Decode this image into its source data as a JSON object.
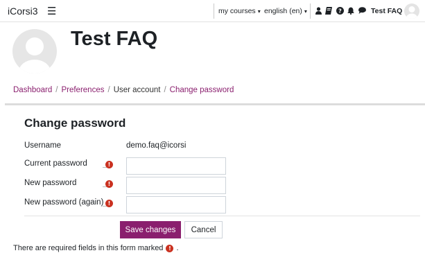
{
  "navbar": {
    "brand": "iCorsi3",
    "my_courses": "my courses",
    "language": "english (en)",
    "caret": "▾",
    "user_name": "Test FAQ",
    "icons": [
      "user-icon",
      "book-icon",
      "help-icon",
      "bell-icon",
      "chat-icon"
    ]
  },
  "header": {
    "title": "Test FAQ"
  },
  "breadcrumb": {
    "items": [
      "Dashboard",
      "Preferences",
      "User account",
      "Change password"
    ],
    "separator": "/"
  },
  "form": {
    "title": "Change password",
    "username_label": "Username",
    "username_value": "demo.faq@icorsi",
    "current_password_label": "Current password",
    "new_password_label": "New password",
    "new_password_again_label": "New password (again)",
    "required_mark": "!",
    "save_label": "Save changes",
    "cancel_label": "Cancel",
    "footnote_text": "There are required fields in this form marked",
    "footnote_end": "."
  },
  "colors": {
    "brand_accent": "#8a1f6e",
    "required": "#ca3120"
  }
}
